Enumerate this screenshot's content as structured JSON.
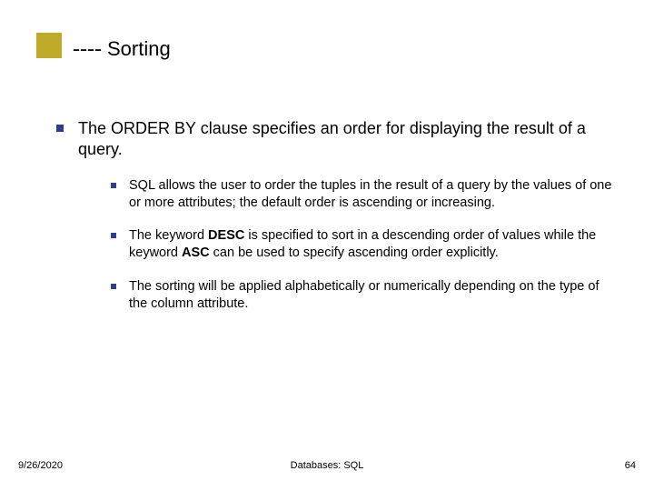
{
  "title": {
    "dashes": "----",
    "text": "Sorting"
  },
  "body": {
    "main": "The ORDER BY clause specifies an order for displaying the result of a query.",
    "sub": [
      "SQL allows the user to order the tuples in the result of a query by the values of one or more attributes; the default order is ascending or increasing.",
      "The keyword DESC is specified to sort in a descending order of values while the keyword ASC can be used to specify ascending order explicitly.",
      "The sorting will be applied alphabetically or numerically depending on the type of the column attribute."
    ],
    "sub1_html": "The keyword <b>DESC</b> is specified to sort in a descending order of values while the keyword <b>ASC</b> can be used to specify ascending order explicitly."
  },
  "footer": {
    "date": "9/26/2020",
    "title": "Databases: SQL",
    "page": "64"
  },
  "colors": {
    "accent_block": "#c0aa2a",
    "bullet": "#2e3e8e"
  }
}
